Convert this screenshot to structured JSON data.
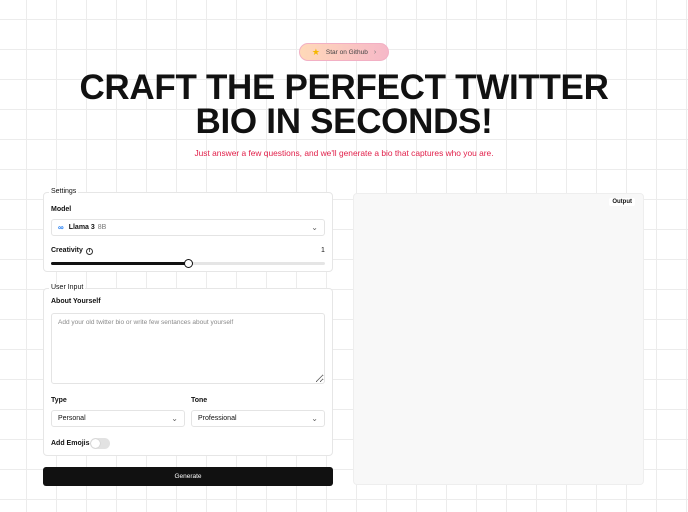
{
  "header": {
    "star_label": "Star on Github",
    "title_line1": "CRAFT THE PERFECT TWITTER",
    "title_line2": "BIO IN SECONDS!",
    "subtitle": "Just answer a few questions, and we'll generate a bio that captures who you are."
  },
  "settings": {
    "legend": "Settings",
    "model_label": "Model",
    "model_name": "Llama 3",
    "model_size": "8B",
    "creativity_label": "Creativity",
    "creativity_value": "1",
    "creativity_fraction": 0.5
  },
  "user_input": {
    "legend": "User Input",
    "about_label": "About Yourself",
    "about_placeholder": "Add your old twitter bio or write few sentances about yourself",
    "type_label": "Type",
    "type_value": "Personal",
    "tone_label": "Tone",
    "tone_value": "Professional",
    "emoji_label": "Add Emojis",
    "emoji_enabled": false
  },
  "actions": {
    "generate_label": "Generate"
  },
  "output": {
    "label": "Output"
  },
  "colors": {
    "accent": "#e11d48",
    "button": "#111111",
    "meta_blue": "#1877f2"
  }
}
